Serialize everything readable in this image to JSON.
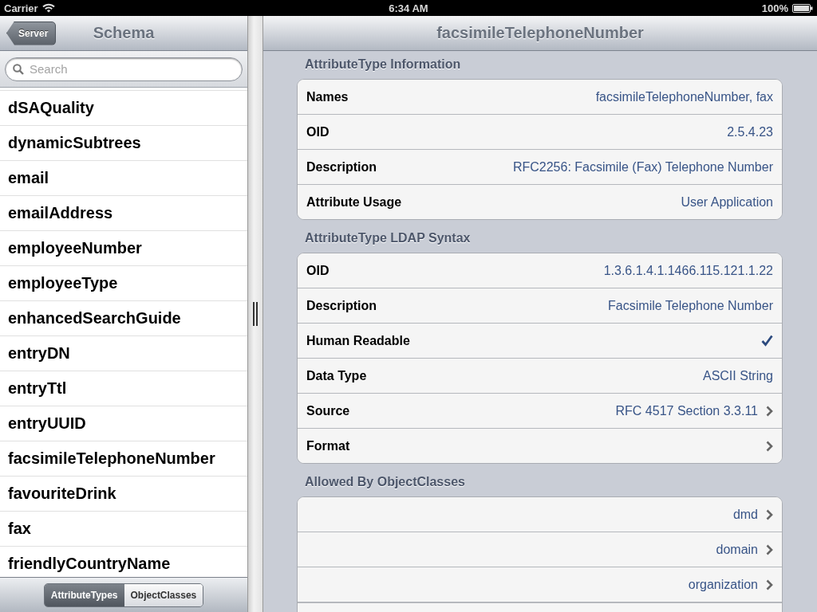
{
  "status_bar": {
    "carrier": "Carrier",
    "time": "6:34 AM",
    "battery": "100%"
  },
  "master": {
    "title": "Schema",
    "back_button": "Server",
    "search": {
      "placeholder": "Search"
    },
    "items": [
      "dSAQuality",
      "dynamicSubtrees",
      "email",
      "emailAddress",
      "employeeNumber",
      "employeeType",
      "enhancedSearchGuide",
      "entryDN",
      "entryTtl",
      "entryUUID",
      "facsimileTelephoneNumber",
      "favouriteDrink",
      "fax",
      "friendlyCountryName"
    ],
    "segments": [
      {
        "label": "AttributeTypes",
        "selected": true
      },
      {
        "label": "ObjectClasses",
        "selected": false
      }
    ]
  },
  "detail": {
    "title": "facsimileTelephoneNumber",
    "sections": [
      {
        "header": "AttributeType Information",
        "rows": [
          {
            "kind": "text",
            "label": "Names",
            "value": "facsimileTelephoneNumber, fax",
            "disclosure": false
          },
          {
            "kind": "text",
            "label": "OID",
            "value": "2.5.4.23",
            "disclosure": false
          },
          {
            "kind": "text",
            "label": "Description",
            "value": "RFC2256: Facsimile (Fax) Telephone Number",
            "disclosure": false
          },
          {
            "kind": "text",
            "label": "Attribute Usage",
            "value": "User Application",
            "disclosure": false
          }
        ]
      },
      {
        "header": "AttributeType LDAP Syntax",
        "rows": [
          {
            "kind": "text",
            "label": "OID",
            "value": "1.3.6.1.4.1.1466.115.121.1.22",
            "disclosure": false
          },
          {
            "kind": "text",
            "label": "Description",
            "value": "Facsimile Telephone Number",
            "disclosure": false
          },
          {
            "kind": "check",
            "label": "Human Readable",
            "checked": true,
            "disclosure": false
          },
          {
            "kind": "text",
            "label": "Data Type",
            "value": "ASCII String",
            "disclosure": false
          },
          {
            "kind": "text",
            "label": "Source",
            "value": "RFC 4517 Section 3.3.11",
            "disclosure": true
          },
          {
            "kind": "text",
            "label": "Format",
            "disclosure": true
          }
        ]
      },
      {
        "header": "Allowed By ObjectClasses",
        "rows": [
          {
            "kind": "text",
            "value": "dmd",
            "disclosure": true
          },
          {
            "kind": "text",
            "value": "domain",
            "disclosure": true
          },
          {
            "kind": "text",
            "value": "organization",
            "disclosure": true
          }
        ]
      }
    ]
  }
}
